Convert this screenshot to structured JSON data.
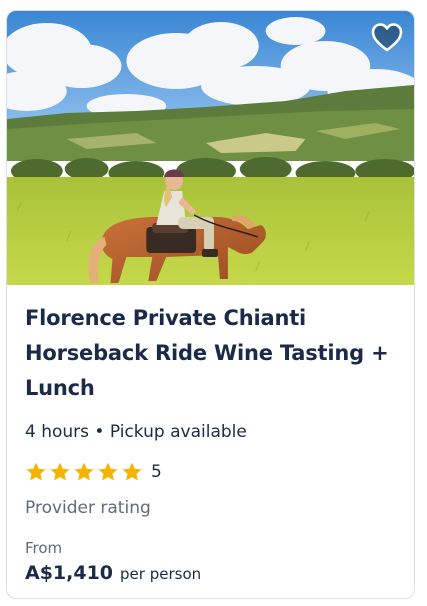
{
  "card": {
    "image_alt": "Rider on a chestnut horse in a green Chianti meadow",
    "wishlist_icon": "heart-icon",
    "title": "Florence Private Chianti Horseback Ride Wine Tasting + Lunch",
    "duration": "4 hours",
    "separator": "•",
    "pickup": "Pickup available",
    "rating": {
      "stars": 5,
      "value": "5",
      "star_color": "#f4b400"
    },
    "provider_label": "Provider rating",
    "price": {
      "from_label": "From",
      "amount": "A$1,410",
      "unit": "per person"
    }
  }
}
